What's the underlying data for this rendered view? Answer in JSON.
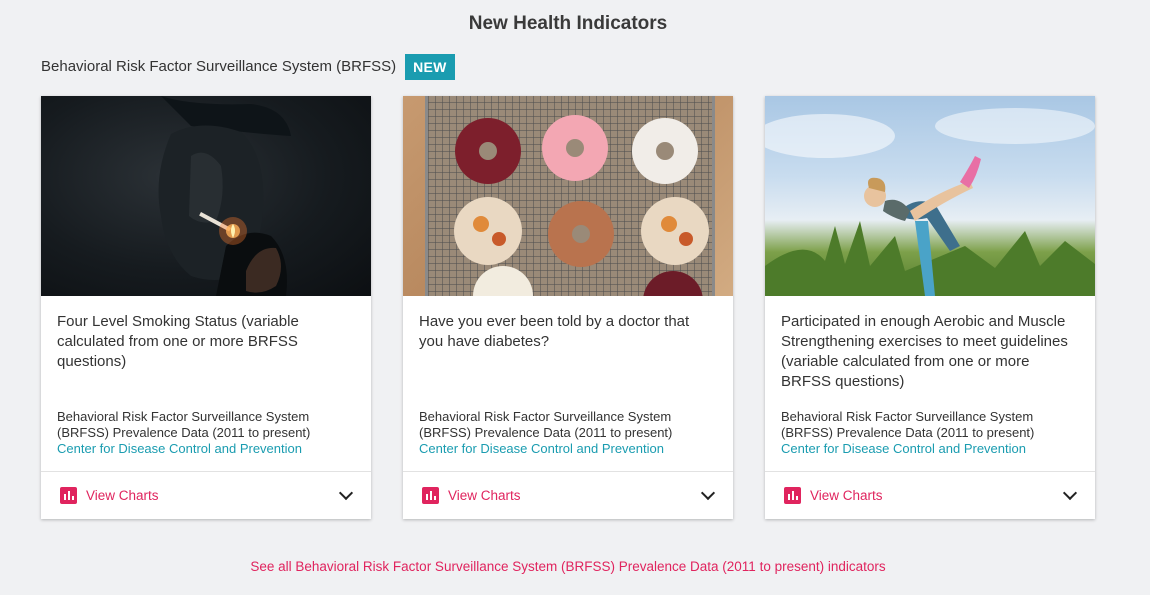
{
  "page_title": "New Health Indicators",
  "section": {
    "title": "Behavioral Risk Factor Surveillance System (BRFSS)",
    "badge": "NEW"
  },
  "cards": [
    {
      "image": "person-lighting-cigarette",
      "title": "Four Level Smoking Status (variable calculated from one or more BRFSS questions)",
      "source": "Behavioral Risk Factor Surveillance System (BRFSS) Prevalence Data (2011 to present)",
      "org": "Center for Disease Control and Prevention",
      "action": "View Charts"
    },
    {
      "image": "donuts-on-cooling-rack",
      "title": "Have you ever been told by a doctor that you have diabetes?",
      "source": "Behavioral Risk Factor Surveillance System (BRFSS) Prevalence Data (2011 to present)",
      "org": "Center for Disease Control and Prevention",
      "action": "View Charts"
    },
    {
      "image": "woman-doing-yoga-in-field",
      "title": "Participated in enough Aerobic and Muscle Strengthening exercises to meet guidelines (variable calculated from one or more BRFSS questions)",
      "source": "Behavioral Risk Factor Surveillance System (BRFSS) Prevalence Data (2011 to present)",
      "org": "Center for Disease Control and Prevention",
      "action": "View Charts"
    }
  ],
  "see_all": "See all Behavioral Risk Factor Surveillance System (BRFSS) Prevalence Data (2011 to present) indicators",
  "colors": {
    "accent": "#e0245e",
    "teal": "#1a9cb0",
    "background": "#f0f1f3"
  }
}
